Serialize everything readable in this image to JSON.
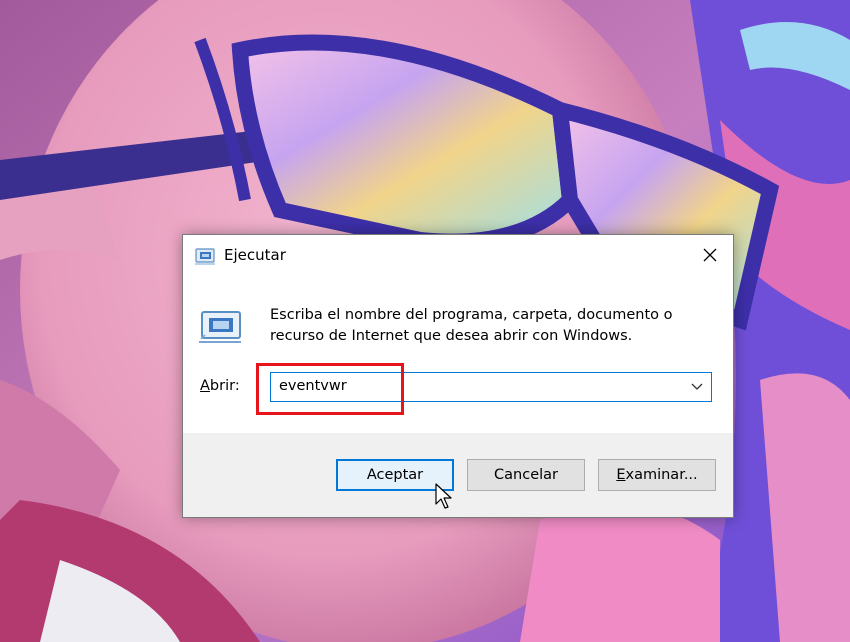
{
  "dialog": {
    "title": "Ejecutar",
    "description_line1": "Escriba el nombre del programa, carpeta, documento o",
    "description_line2": "recurso de Internet que desea abrir con Windows.",
    "open_label_accesskey": "A",
    "open_label_rest": "brir:",
    "command_value": "eventvwr",
    "icons": {
      "title": "run-icon",
      "close": "close-icon",
      "large": "run-icon",
      "dropdown": "chevron-down-icon",
      "pointer": "mouse-pointer-icon"
    }
  },
  "buttons": {
    "ok_label": "Aceptar",
    "cancel_label": "Cancelar",
    "browse_accesskey": "E",
    "browse_rest": "xaminar..."
  },
  "colors": {
    "accent": "#0078d7",
    "highlight": "#e8141b",
    "dialog_footer": "#f0f0f0"
  }
}
